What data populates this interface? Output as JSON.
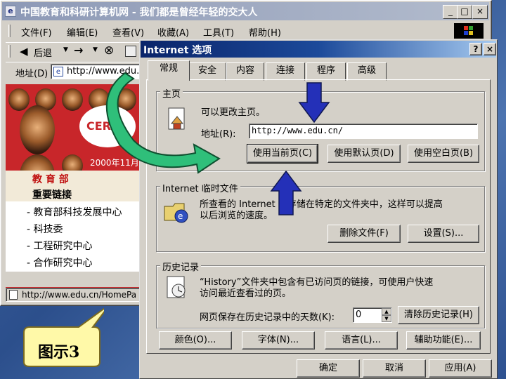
{
  "colors": {
    "title_active": "#0a246a",
    "arrow_blue": "#2430b8",
    "arrow_green": "#2fbf7a",
    "web_red": "#c8262a"
  },
  "browser": {
    "title": "中国教育和科研计算机网 - 我们都是曾经年轻的交大人",
    "caption_buttons": [
      "_",
      "□",
      "×"
    ],
    "menu": [
      "文件(F)",
      "编辑(E)",
      "查看(V)",
      "收藏(A)",
      "工具(T)",
      "帮助(H)"
    ],
    "toolbar": {
      "back": "后退",
      "forward": "→",
      "stop": "⊗"
    },
    "address_label": "地址(D)",
    "address_value": "http://www.edu.",
    "status_url": "http://www.edu.cn/HomePa",
    "page": {
      "cernet": "CERN",
      "date": "2000年11月",
      "ministry": "教 育 部",
      "links_heading": "重要链接",
      "links": [
        "- 教育部科技发展中心",
        "- 科技委",
        "- 工程研究中心",
        "- 合作研究中心"
      ]
    }
  },
  "callout": {
    "label": "图示3"
  },
  "dialog": {
    "title": "Internet 选项",
    "help_btn": "?",
    "close_btn": "×",
    "tabs": [
      "常规",
      "安全",
      "内容",
      "连接",
      "程序",
      "高级"
    ],
    "home": {
      "group": "主页",
      "desc": "可以更改主页。",
      "addr_label": "地址(R):",
      "addr_value": "http://www.edu.cn/",
      "buttons": [
        "使用当前页(C)",
        "使用默认页(D)",
        "使用空白页(B)"
      ]
    },
    "temp": {
      "group": "Internet 临时文件",
      "desc1": "所查看的 Internet 页存储在特定的文件夹中，这样可以提高",
      "desc2": "以后浏览的速度。",
      "buttons": [
        "删除文件(F)",
        "设置(S)..."
      ]
    },
    "history": {
      "group": "历史记录",
      "desc1": "“History”文件夹中包含有已访问页的链接，可使用户快速",
      "desc2": "访问最近查看过的页。",
      "days_label": "网页保存在历史记录中的天数(K):",
      "days_value": "0",
      "clear_btn": "清除历史记录(H)"
    },
    "bottom_buttons": [
      "颜色(O)...",
      "字体(N)...",
      "语言(L)...",
      "辅助功能(E)..."
    ],
    "footer_buttons": [
      "确定",
      "取消",
      "应用(A)"
    ]
  }
}
